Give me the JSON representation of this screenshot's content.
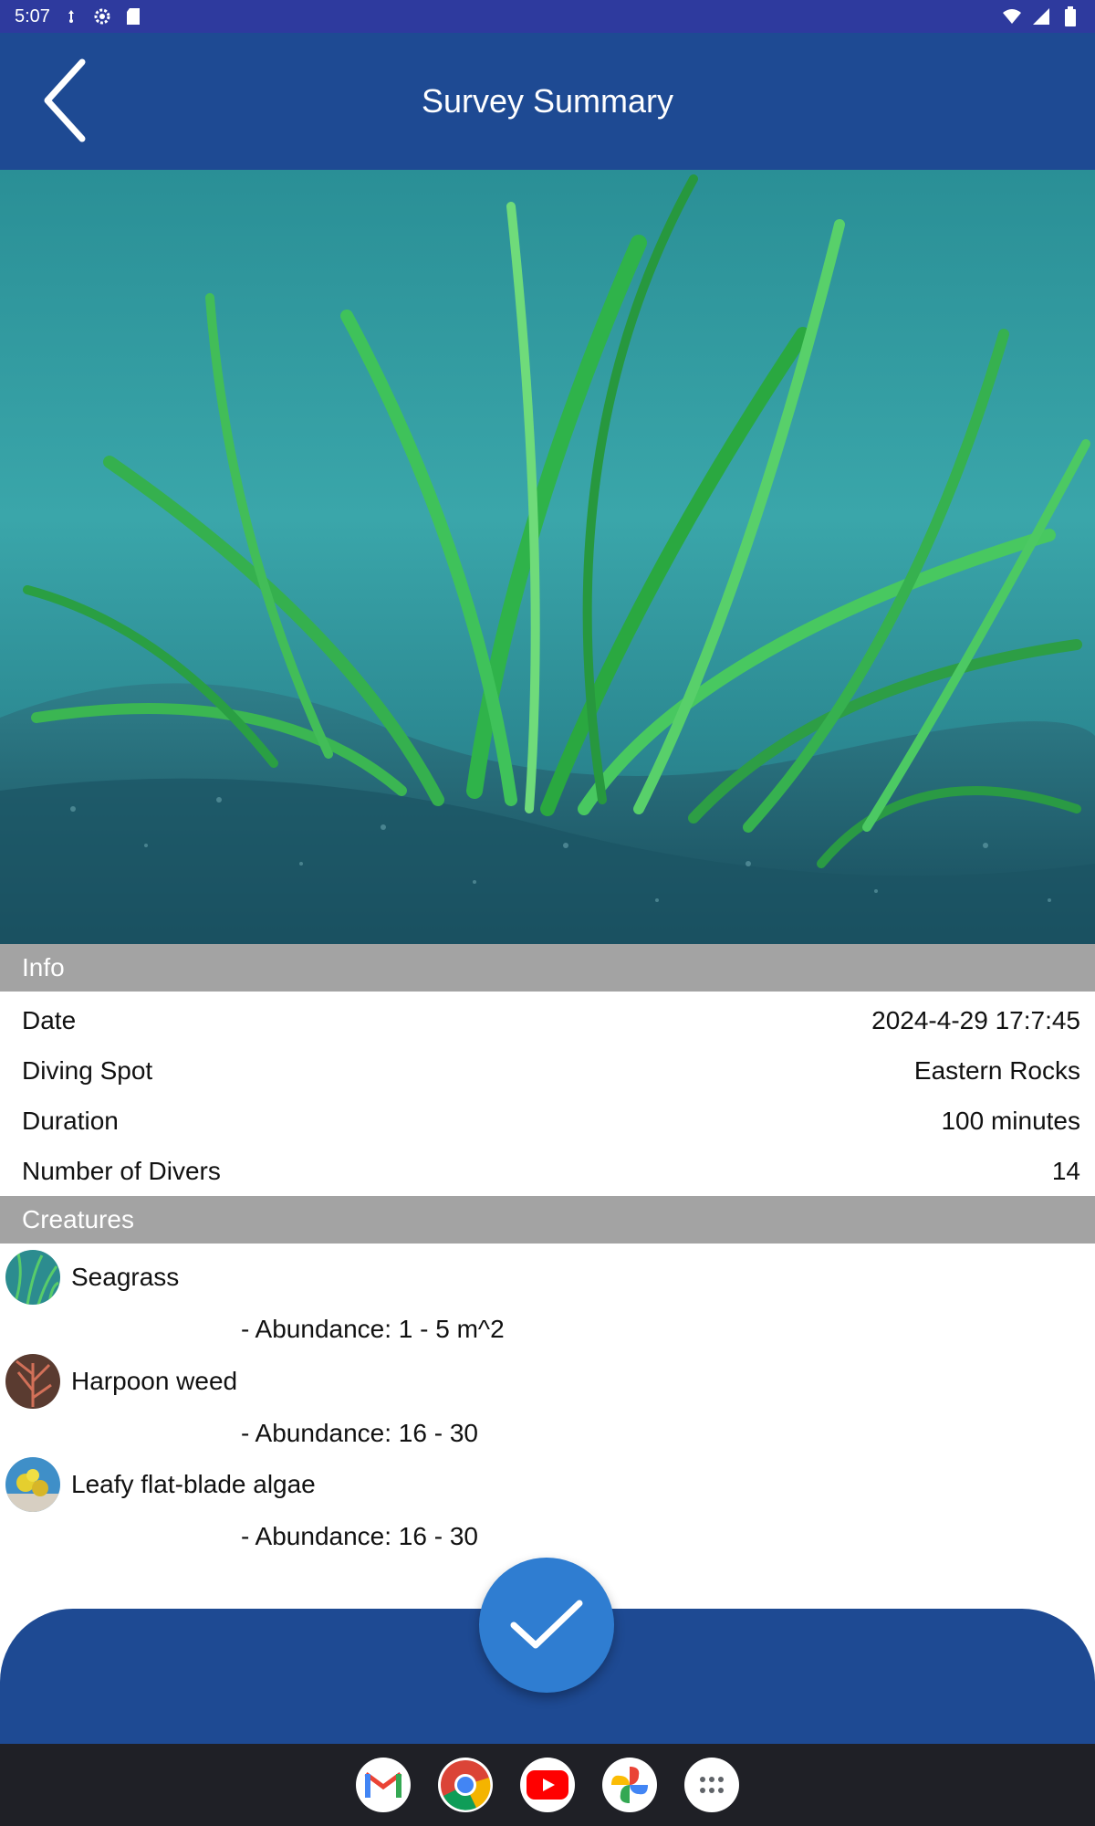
{
  "status_bar": {
    "time": "5:07",
    "icons_left": [
      "usb-debug-icon",
      "settings-icon",
      "sd-card-icon"
    ],
    "icons_right": [
      "wifi-icon",
      "signal-icon",
      "battery-icon"
    ]
  },
  "app_bar": {
    "title": "Survey Summary",
    "back_icon": "chevron-left-icon"
  },
  "hero": {
    "description_icon": "seagrass-photo"
  },
  "info": {
    "header": "Info",
    "rows": [
      {
        "label": "Date",
        "value": "2024-4-29 17:7:45"
      },
      {
        "label": "Diving Spot",
        "value": "Eastern Rocks"
      },
      {
        "label": "Duration",
        "value": "100 minutes"
      },
      {
        "label": "Number of Divers",
        "value": "14"
      }
    ]
  },
  "creatures": {
    "header": "Creatures",
    "items": [
      {
        "name": "Seagrass",
        "abundance": "- Abundance: 1 - 5 m^2",
        "thumb_color": "#2f8f7a"
      },
      {
        "name": "Harpoon weed",
        "abundance": "- Abundance: 16 - 30",
        "thumb_color": "#a8523d"
      },
      {
        "name": "Leafy flat-blade algae",
        "abundance": "- Abundance: 16 - 30",
        "thumb_color": "#d4c23a"
      }
    ]
  },
  "fab": {
    "icon": "check-icon"
  },
  "dock": {
    "apps": [
      "gmail-icon",
      "chrome-icon",
      "youtube-icon",
      "photos-icon",
      "app-drawer-icon"
    ]
  },
  "colors": {
    "status_bar": "#2e3a9e",
    "app_bar": "#1e4a93",
    "section_header": "#a3a3a3",
    "fab": "#2f7dd1",
    "dock": "#1f2026"
  }
}
